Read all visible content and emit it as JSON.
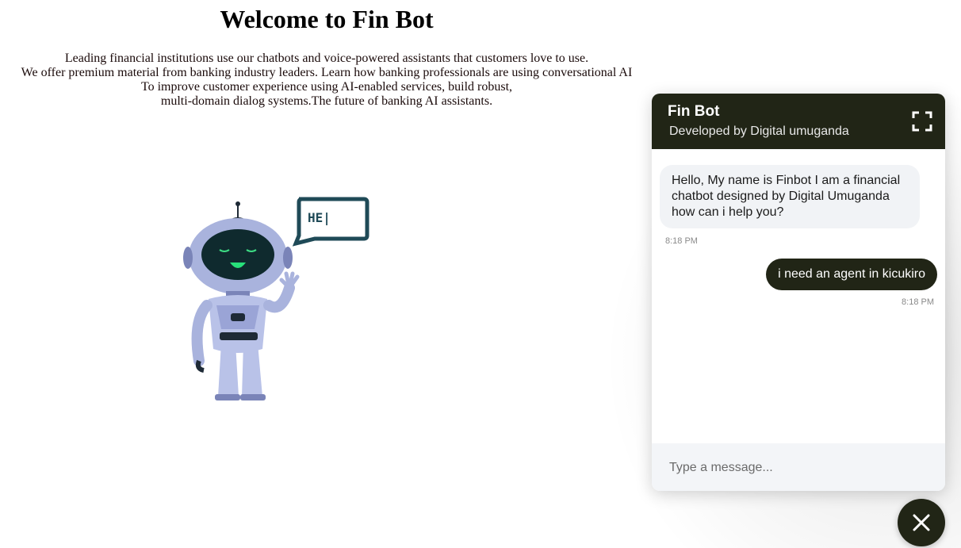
{
  "page": {
    "title": "Welcome to Fin Bot",
    "intro_lines": [
      "Leading financial institutions use our chatbots and voice-powered assistants that customers love to use.",
      "We offer premium material from banking industry leaders. Learn how banking professionals are using conversational AI",
      "To improve customer experience using AI-enabled services, build robust,",
      "multi-domain dialog systems.The future of banking AI assistants."
    ],
    "robot": {
      "speech_text": "HE|"
    }
  },
  "chat": {
    "header": {
      "title": "Fin Bot",
      "subtitle": "Developed by Digital umuganda",
      "expand_icon": "expand-icon"
    },
    "messages": [
      {
        "sender": "bot",
        "text": "Hello, My name is Finbot I am a financial chatbot designed by Digital Umuganda how can i help you?",
        "time": "8:18 PM"
      },
      {
        "sender": "user",
        "text": "i need an agent in kicukiro",
        "time": "8:18 PM"
      }
    ],
    "composer": {
      "placeholder": "Type a message...",
      "value": ""
    },
    "close_icon": "close-icon"
  },
  "colors": {
    "accent": "#212516",
    "bot_bubble": "#f1f3f6",
    "composer_bg": "#f3f5f8"
  }
}
